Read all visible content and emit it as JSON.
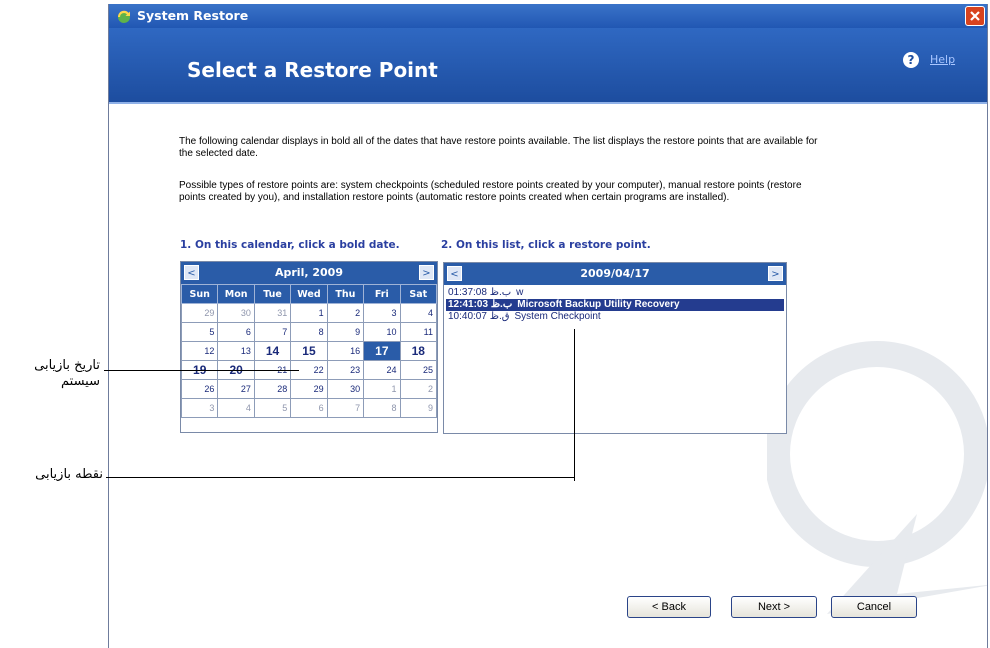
{
  "window": {
    "title": "System Restore",
    "heading": "Select a Restore Point",
    "help_label": "Help"
  },
  "body": {
    "paragraph1": "The following calendar displays in bold all of the dates that have restore points available. The list displays the restore points that are available for the selected date.",
    "paragraph2": "Possible types of restore points are: system checkpoints (scheduled restore points created by your computer), manual restore points (restore points created by you), and installation restore points (automatic restore points created when certain programs are installed).",
    "step1_label": "1. On this calendar, click a bold date.",
    "step2_label": "2. On this list, click a restore point."
  },
  "calendar": {
    "month_label": "April, 2009",
    "prev": "<",
    "next": ">",
    "weekdays": [
      "Sun",
      "Mon",
      "Tue",
      "Wed",
      "Thu",
      "Fri",
      "Sat"
    ],
    "weeks": [
      [
        "29",
        "30",
        "31",
        "1",
        "2",
        "3",
        "4"
      ],
      [
        "5",
        "6",
        "7",
        "8",
        "9",
        "10",
        "11"
      ],
      [
        "12",
        "13",
        "14",
        "15",
        "16",
        "17",
        "18"
      ],
      [
        "19",
        "20",
        "21",
        "22",
        "23",
        "24",
        "25"
      ],
      [
        "26",
        "27",
        "28",
        "29",
        "30",
        "1",
        "2"
      ],
      [
        "3",
        "4",
        "5",
        "6",
        "7",
        "8",
        "9"
      ]
    ],
    "selected_day": "17",
    "bold_days": [
      "14",
      "15",
      "18",
      "19",
      "20"
    ]
  },
  "restore_list": {
    "date_label": "2009/04/17",
    "prev": "<",
    "next": ">",
    "items": [
      {
        "time": "01:37:08 ب.ظ",
        "name": "w"
      },
      {
        "time": "12:41:03 ب.ظ",
        "name": "Microsoft Backup Utility Recovery"
      },
      {
        "time": "10:40:07 ق.ظ",
        "name": "System Checkpoint"
      }
    ],
    "selected_index": 1
  },
  "buttons": {
    "back": "< Back",
    "next": "Next >",
    "cancel": "Cancel"
  },
  "annotations": {
    "restore_date_line1": "تاریخ بازیابی",
    "restore_date_line2": "سیستم",
    "restore_point": "نقطه بازیابی"
  }
}
